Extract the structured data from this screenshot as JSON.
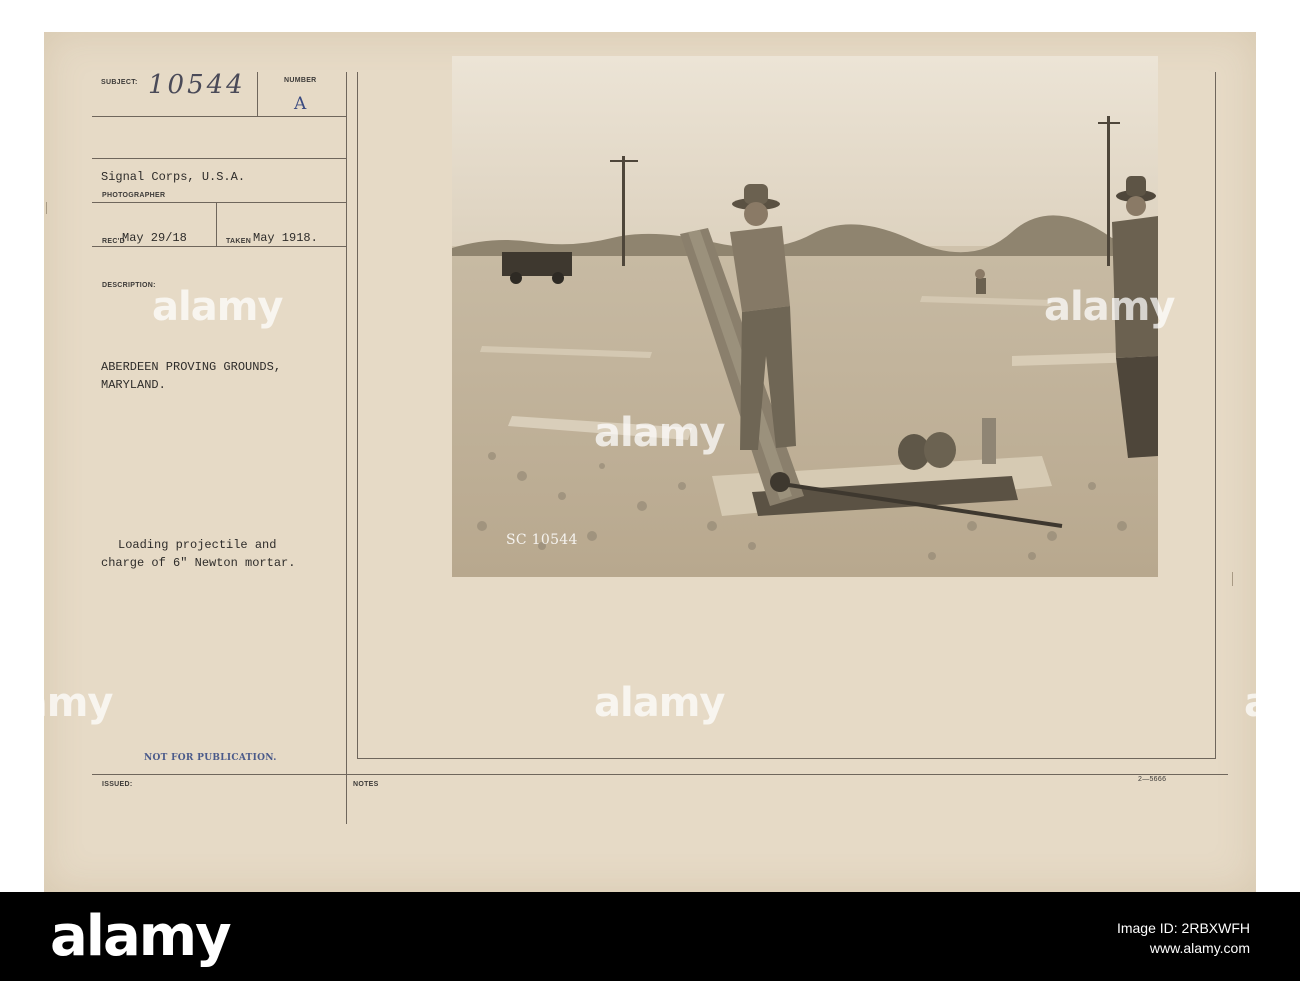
{
  "card": {
    "subject_label": "SUBJECT:",
    "subject_value": "10544",
    "number_label": "NUMBER",
    "number_value": "A",
    "photographer_value": "Signal Corps, U.S.A.",
    "photographer_label": "PHOTOGRAPHER",
    "recd_label": "REC'D",
    "recd_value": "May 29/18",
    "taken_label": "TAKEN",
    "taken_value": "May 1918.",
    "description_label": "DESCRIPTION:",
    "location_line1": "ABERDEEN PROVING GROUNDS,",
    "location_line2": "MARYLAND.",
    "caption_line1": "Loading projectile and",
    "caption_line2": "charge of 6\" Newton mortar.",
    "stamp": "NOT FOR PUBLICATION.",
    "issued_label": "ISSUED:",
    "notes_label": "NOTES",
    "form_number": "2—5666"
  },
  "photo": {
    "negative_number": "SC 10544"
  },
  "watermark": {
    "text": "alamy"
  },
  "footer": {
    "logo": "alamy",
    "image_id_line": "Image ID: 2RBXWFH",
    "site": "www.alamy.com"
  },
  "colors": {
    "card": "#e6dac6",
    "ink": "#2e2c2a",
    "stamp_blue": "#4a5a8a",
    "handwriting": "#4a4a58",
    "footer": "#000000"
  }
}
